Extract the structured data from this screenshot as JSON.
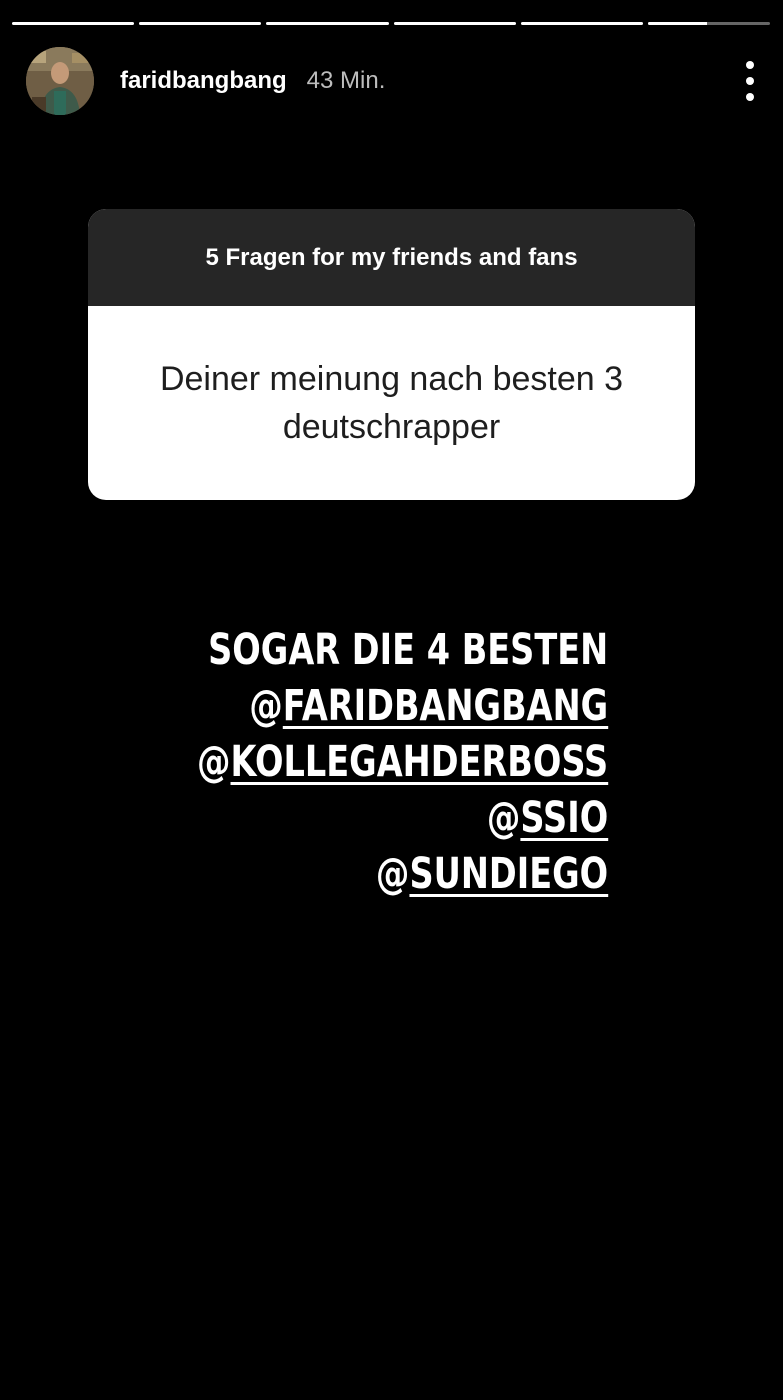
{
  "story": {
    "progress_segments": [
      1,
      1,
      1,
      1,
      1,
      0.48
    ]
  },
  "header": {
    "username": "faridbangbang",
    "time": "43 Min.",
    "avatar_icon": "avatar-photo",
    "menu_icon": "more-vertical-icon"
  },
  "question_card": {
    "title": "5 Fragen for my friends and fans",
    "question": "Deiner meinung nach besten 3 deutschrapper"
  },
  "answer": {
    "headline": "SOGAR DIE 4 BESTEN",
    "mentions": [
      {
        "at": "@",
        "name": "FARIDBANGBANG"
      },
      {
        "at": "@",
        "name": "KOLLEGAHDERBOSS"
      },
      {
        "at": "@",
        "name": "SSIO"
      },
      {
        "at": "@",
        "name": "SUNDIEGO"
      }
    ]
  },
  "colors": {
    "background": "#000000",
    "card_header": "#262626",
    "card_body": "#ffffff",
    "progress_active": "#ffffff",
    "progress_inactive": "#666666"
  }
}
